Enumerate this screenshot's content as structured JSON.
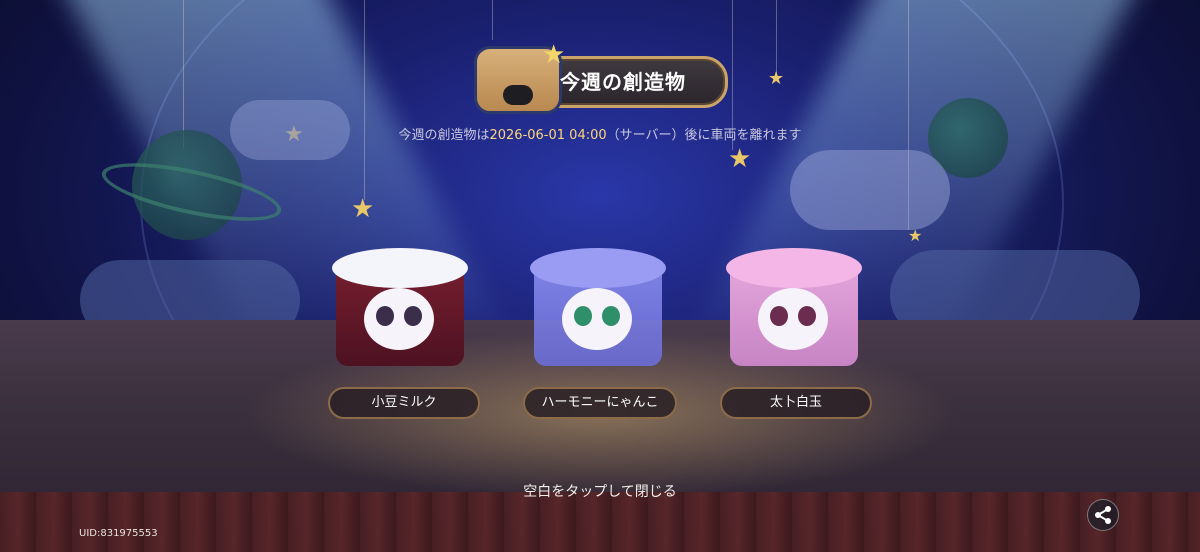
{
  "header": {
    "title": "今週の創造物",
    "subtitle_prefix": "今週の創造物は",
    "subtitle_datetime": "2026-06-01 04:00",
    "subtitle_suffix": "（サーバー）後に車両を離れます"
  },
  "creations": [
    {
      "name": "小豆ミルク"
    },
    {
      "name": "ハーモニーにゃんこ"
    },
    {
      "name": "太卜白玉"
    }
  ],
  "footer": {
    "close_hint": "空白をタップして閉じる",
    "uid": "UID:831975553"
  },
  "icons": {
    "title": "creature-box-icon",
    "share": "share-icon"
  },
  "colors": {
    "highlight": "#ffd47a",
    "label_border": "#8c6b49"
  }
}
